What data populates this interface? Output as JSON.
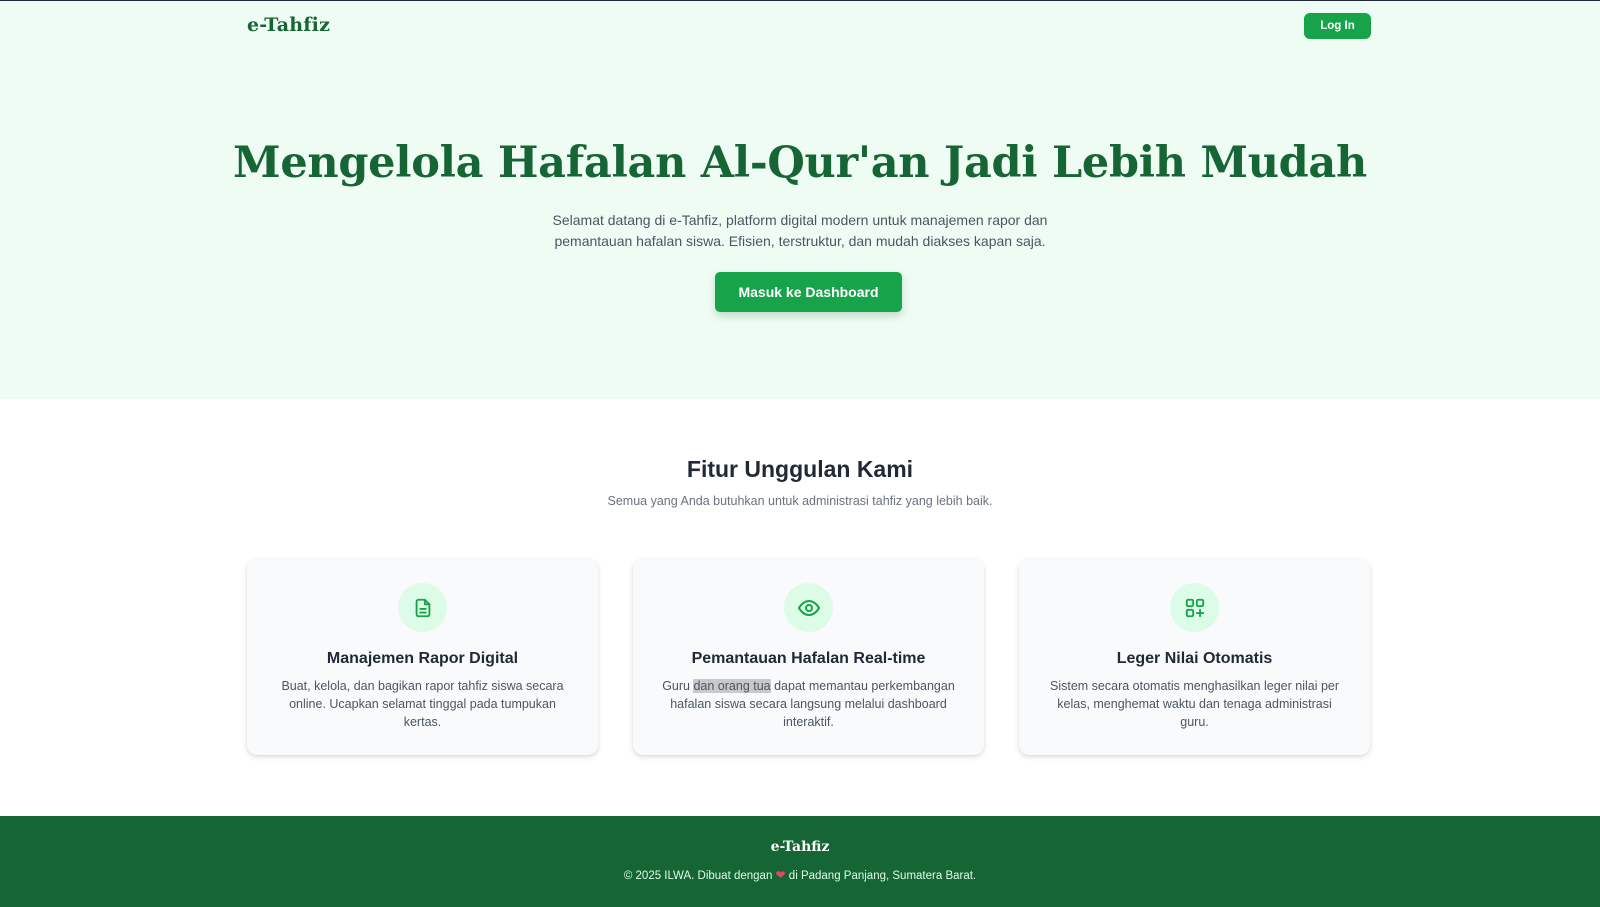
{
  "colors": {
    "brand_green": "#166534",
    "button_green": "#16a34a",
    "hero_bg": "#effcf4",
    "icon_bg": "#dcfce7",
    "footer_bg": "#166534",
    "heart": "#f43f5e"
  },
  "navbar": {
    "brand": "e-Tahfiz",
    "login_label": "Log In"
  },
  "hero": {
    "title": "Mengelola Hafalan Al-Qur'an Jadi Lebih Mudah",
    "subtitle": "Selamat datang di e-Tahfiz, platform digital modern untuk manajemen rapor dan pemantauan hafalan siswa. Efisien, terstruktur, dan mudah diakses kapan saja.",
    "cta_label": "Masuk ke Dashboard"
  },
  "features": {
    "title": "Fitur Unggulan Kami",
    "subtitle": "Semua yang Anda butuhkan untuk administrasi tahfiz yang lebih baik.",
    "cards": [
      {
        "icon": "document-icon",
        "title": "Manajemen Rapor Digital",
        "description": "Buat, kelola, dan bagikan rapor tahfiz siswa secara online. Ucapkan selamat tinggal pada tumpukan kertas."
      },
      {
        "icon": "eye-icon",
        "title": "Pemantauan Hafalan Real-time",
        "description_before": "Guru ",
        "description_highlight": "dan orang tua",
        "description_after": " dapat memantau perkembangan hafalan siswa secara langsung melalui dashboard interaktif."
      },
      {
        "icon": "grid-plus-icon",
        "title": "Leger Nilai Otomatis",
        "description": "Sistem secara otomatis menghasilkan leger nilai per kelas, menghemat waktu dan tenaga administrasi guru."
      }
    ]
  },
  "footer": {
    "brand": "e-Tahfiz",
    "copy_before": "© 2025 ILWA. Dibuat dengan ",
    "copy_after": " di Padang Panjang, Sumatera Barat.",
    "heart_icon": "heart-icon"
  }
}
